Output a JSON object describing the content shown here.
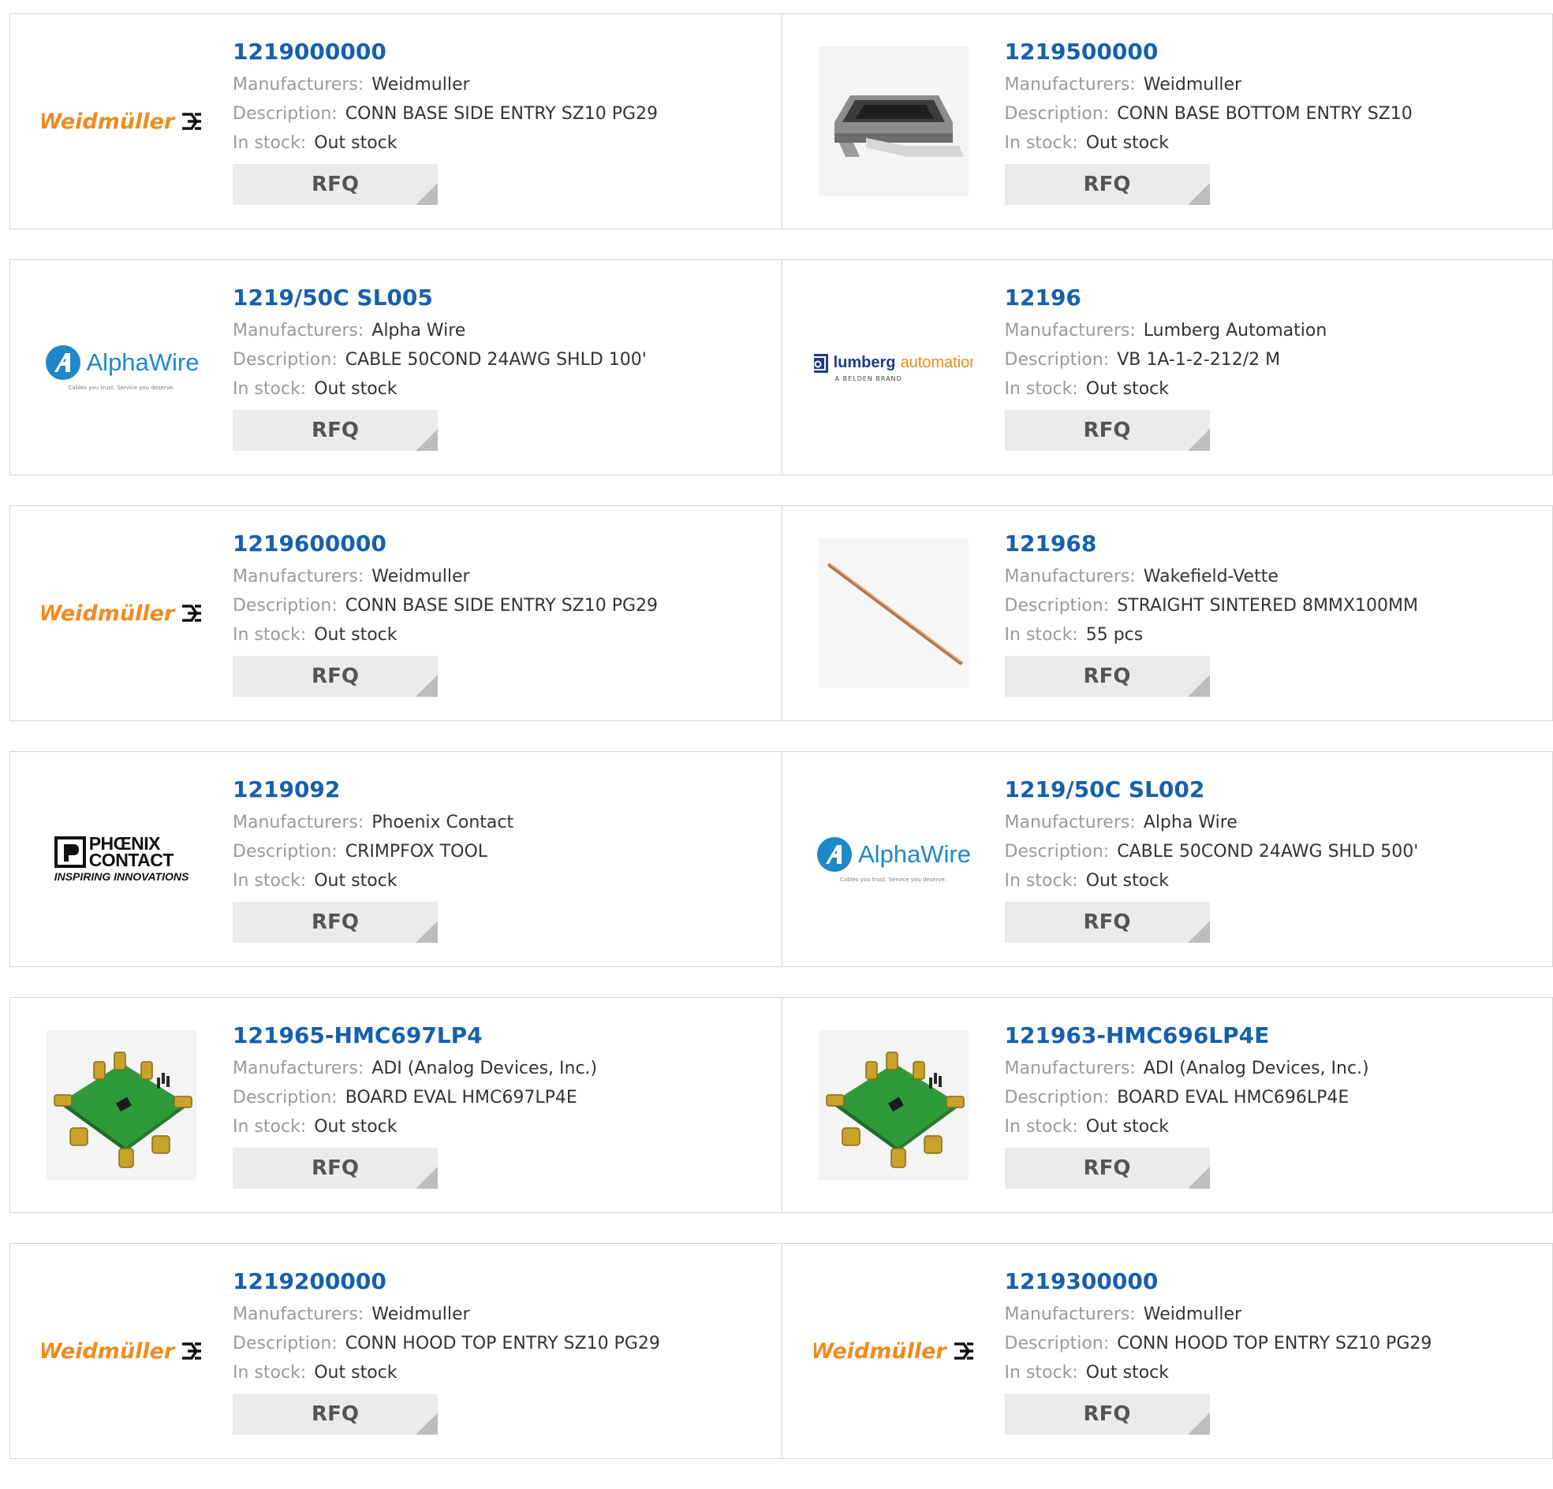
{
  "labels": {
    "manufacturers": "Manufacturers:",
    "description": "Description:",
    "in_stock": "In stock:",
    "rfq": "RFQ"
  },
  "logos": {
    "weidmuller": "Weidmüller",
    "alphawire": "AlphaWire",
    "alphawire_tagline": "Cables you trust. Service you deserve.",
    "lumberg_a": "lumberg",
    "lumberg_b": "automation",
    "lumberg_sub": "A BELDEN BRAND",
    "phoenix_name_1": "PHŒNIX",
    "phoenix_name_2": "CONTACT",
    "phoenix_tag": "INSPIRING INNOVATIONS"
  },
  "colors": {
    "part_link": "#1560ad",
    "weidmuller_orange": "#f08a1d",
    "alphawire_blue": "#1e88c9"
  },
  "products": [
    {
      "part": "1219000000",
      "manufacturer": "Weidmuller",
      "description": "CONN BASE SIDE ENTRY SZ10 PG29",
      "stock": "Out stock",
      "image": "weidmuller-logo"
    },
    {
      "part": "1219500000",
      "manufacturer": "Weidmuller",
      "description": "CONN BASE BOTTOM ENTRY SZ10",
      "stock": "Out stock",
      "image": "connector-base-photo"
    },
    {
      "part": "1219/50C SL005",
      "manufacturer": "Alpha Wire",
      "description": "CABLE 50COND 24AWG SHLD 100'",
      "stock": "Out stock",
      "image": "alphawire-logo"
    },
    {
      "part": "12196",
      "manufacturer": "Lumberg Automation",
      "description": "VB 1A-1-2-212/2 M",
      "stock": "Out stock",
      "image": "lumberg-logo"
    },
    {
      "part": "1219600000",
      "manufacturer": "Weidmuller",
      "description": "CONN BASE SIDE ENTRY SZ10 PG29",
      "stock": "Out stock",
      "image": "weidmuller-logo"
    },
    {
      "part": "121968",
      "manufacturer": "Wakefield-Vette",
      "description": "STRAIGHT SINTERED 8MMX100MM",
      "stock": "55 pcs",
      "image": "heat-pipe-photo"
    },
    {
      "part": "1219092",
      "manufacturer": "Phoenix Contact",
      "description": "CRIMPFOX TOOL",
      "stock": "Out stock",
      "image": "phoenix-contact-logo"
    },
    {
      "part": "1219/50C SL002",
      "manufacturer": "Alpha Wire",
      "description": "CABLE 50COND 24AWG SHLD 500'",
      "stock": "Out stock",
      "image": "alphawire-logo"
    },
    {
      "part": "121965-HMC697LP4",
      "manufacturer": "ADI (Analog Devices, Inc.)",
      "description": "BOARD EVAL HMC697LP4E",
      "stock": "Out stock",
      "image": "eval-board-photo"
    },
    {
      "part": "121963-HMC696LP4E",
      "manufacturer": "ADI (Analog Devices, Inc.)",
      "description": "BOARD EVAL HMC696LP4E",
      "stock": "Out stock",
      "image": "eval-board-photo"
    },
    {
      "part": "1219200000",
      "manufacturer": "Weidmuller",
      "description": "CONN HOOD TOP ENTRY SZ10 PG29",
      "stock": "Out stock",
      "image": "weidmuller-logo"
    },
    {
      "part": "1219300000",
      "manufacturer": "Weidmuller",
      "description": "CONN HOOD TOP ENTRY SZ10 PG29",
      "stock": "Out stock",
      "image": "weidmuller-logo"
    }
  ]
}
